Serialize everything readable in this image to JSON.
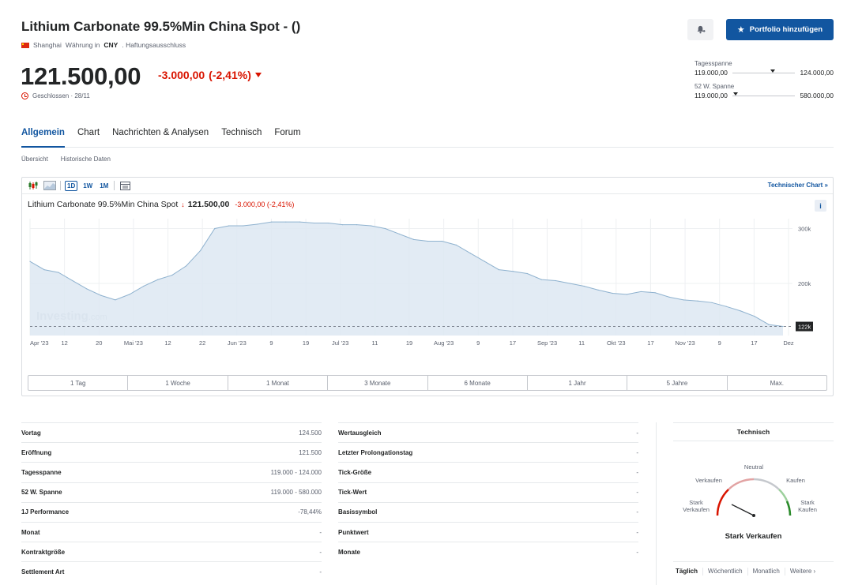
{
  "header": {
    "title": "Lithium Carbonate 99.5%Min China Spot - ()",
    "exchange": "Shanghai",
    "currency_prefix": "Währung in",
    "currency": "CNY",
    "disclaimer": ". Haftungsausschluss",
    "price": "121.500,00",
    "change": "-3.000,00",
    "change_pct": "(-2,41%)",
    "status": "Geschlossen · 28/11",
    "portfolio_button": "Portfolio hinzufügen"
  },
  "ranges": {
    "day_label": "Tagesspanne",
    "day_low": "119.000,00",
    "day_high": "124.000,00",
    "day_position": 0.6,
    "week52_label": "52 W. Spanne",
    "week52_low": "119.000,00",
    "week52_high": "580.000,00",
    "week52_position": 0.01
  },
  "tabs": [
    "Allgemein",
    "Chart",
    "Nachrichten & Analysen",
    "Technisch",
    "Forum"
  ],
  "subtabs": [
    "Übersicht",
    "Historische Daten"
  ],
  "toolbar": {
    "btn_1d": "1D",
    "btn_1w": "1W",
    "btn_1m": "1M",
    "tech_chart_link": "Technischer Chart »"
  },
  "chart_header": {
    "name": "Lithium Carbonate 99.5%Min China Spot",
    "arrow": "↓",
    "price": "121.500,00",
    "change": "-3.000,00 (-2,41%)",
    "info": "i"
  },
  "chart_data": {
    "type": "area",
    "x_labels": [
      "Apr '23",
      "12",
      "20",
      "Mai '23",
      "12",
      "22",
      "Jun '23",
      "9",
      "19",
      "Jul '23",
      "11",
      "19",
      "Aug '23",
      "9",
      "17",
      "Sep '23",
      "11",
      "Okt '23",
      "17",
      "Nov '23",
      "9",
      "17",
      "Dez"
    ],
    "y_ticks": [
      "300k",
      "200k"
    ],
    "last_value_label": "122k",
    "watermark": "Investing",
    "watermark_suffix": ".com",
    "series": [
      {
        "values": [
          240000,
          225000,
          220000,
          205000,
          190000,
          178000,
          170000,
          180000,
          195000,
          207000,
          215000,
          232000,
          260000,
          300000,
          305000,
          305000,
          308000,
          312000,
          312000,
          312000,
          310000,
          310000,
          307000,
          307000,
          305000,
          300000,
          290000,
          280000,
          277000,
          277000,
          270000,
          255000,
          240000,
          225000,
          222000,
          218000,
          207000,
          205000,
          200000,
          195000,
          188000,
          182000,
          180000,
          185000,
          183000,
          175000,
          170000,
          168000,
          165000,
          158000,
          150000,
          140000,
          125000,
          121500
        ]
      }
    ],
    "ylim": [
      105000,
      318000
    ],
    "grid": true
  },
  "periods": [
    "1 Tag",
    "1 Woche",
    "1 Monat",
    "3 Monate",
    "6 Monate",
    "1 Jahr",
    "5 Jahre",
    "Max."
  ],
  "stats_left": [
    {
      "k": "Vortag",
      "v": "124.500"
    },
    {
      "k": "Eröffnung",
      "v": "121.500"
    },
    {
      "k": "Tagesspanne",
      "v": "119.000 - 124.000"
    },
    {
      "k": "52 W. Spanne",
      "v": "119.000 - 580.000"
    },
    {
      "k": "1J Performance",
      "v": "-78,44%"
    },
    {
      "k": "Monat",
      "v": "-"
    },
    {
      "k": "Kontraktgröße",
      "v": "-"
    },
    {
      "k": "Settlement Art",
      "v": "-"
    }
  ],
  "stats_right": [
    {
      "k": "Wertausgleich",
      "v": "-"
    },
    {
      "k": "Letzter Prolongationstag",
      "v": "-"
    },
    {
      "k": "Tick-Größe",
      "v": "-"
    },
    {
      "k": "Tick-Wert",
      "v": "-"
    },
    {
      "k": "Basissymbol",
      "v": "-"
    },
    {
      "k": "Punktwert",
      "v": "-"
    },
    {
      "k": "Monate",
      "v": "-"
    }
  ],
  "technical": {
    "title": "Technisch",
    "neutral": "Neutral",
    "sell": "Verkaufen",
    "buy": "Kaufen",
    "strong_sell_1": "Stark",
    "strong_sell_2": "Verkaufen",
    "strong_buy_1": "Stark",
    "strong_buy_2": "Kaufen",
    "result": "Stark Verkaufen",
    "tabs": [
      "Täglich",
      "Wöchentlich",
      "Monatlich",
      "Weitere ›"
    ]
  },
  "colors": {
    "accent": "#1256a0",
    "negative": "#d91400",
    "area_fill": "#dde8f2",
    "area_line": "#8fb2cf"
  }
}
